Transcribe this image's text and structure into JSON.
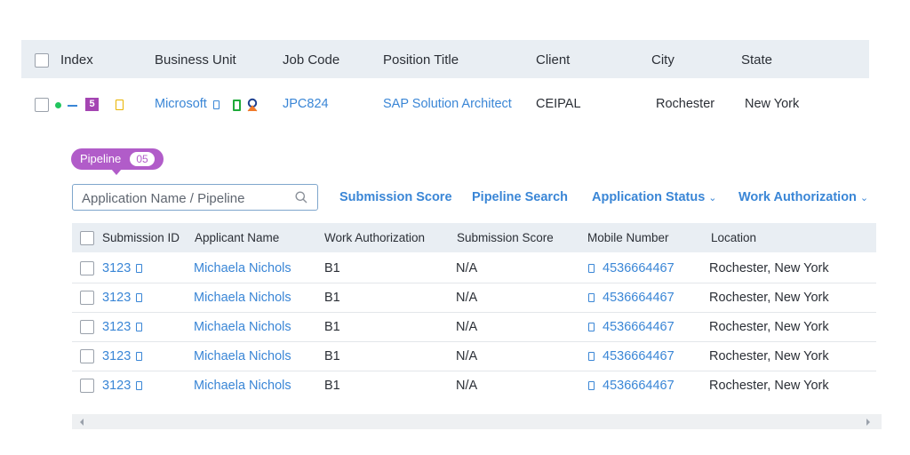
{
  "main_table": {
    "headers": [
      "Index",
      "Business Unit",
      "Job Code",
      "Position Title",
      "Client",
      "City",
      "State"
    ],
    "row": {
      "index_badge": "5",
      "business_unit": "Microsoft",
      "job_code": "JPC824",
      "position_title": "SAP Solution Architect",
      "client": "CEIPAL",
      "city": "Rochester",
      "state": "New York"
    }
  },
  "pipeline": {
    "label": "Pipeline",
    "count": "05",
    "search_placeholder": "Application Name / Pipeline",
    "filters": {
      "submission_score": "Submission Score",
      "pipeline_search": "Pipeline Search",
      "application_status": "Application Status",
      "work_authorization": "Work Authorization"
    }
  },
  "sub_table": {
    "headers": [
      "Submission ID",
      "Applicant Name",
      "Work Authorization",
      "Submission Score",
      "Mobile Number",
      "Location"
    ],
    "rows": [
      {
        "submission_id": "3123",
        "applicant_name": "Michaela Nichols",
        "work_authorization": "B1",
        "submission_score": "N/A",
        "mobile": "4536664467",
        "location": "Rochester, New York"
      },
      {
        "submission_id": "3123",
        "applicant_name": "Michaela Nichols",
        "work_authorization": "B1",
        "submission_score": "N/A",
        "mobile": "4536664467",
        "location": "Rochester, New York"
      },
      {
        "submission_id": "3123",
        "applicant_name": "Michaela Nichols",
        "work_authorization": "B1",
        "submission_score": "N/A",
        "mobile": "4536664467",
        "location": "Rochester, New York"
      },
      {
        "submission_id": "3123",
        "applicant_name": "Michaela Nichols",
        "work_authorization": "B1",
        "submission_score": "N/A",
        "mobile": "4536664467",
        "location": "Rochester, New York"
      },
      {
        "submission_id": "3123",
        "applicant_name": "Michaela Nichols",
        "work_authorization": "B1",
        "submission_score": "N/A",
        "mobile": "4536664467",
        "location": "Rochester, New York"
      }
    ]
  },
  "colors": {
    "link": "#3a86d6",
    "pipeline_purple": "#b15cc9",
    "status_green": "#22c55e",
    "header_bg": "#e9eef3",
    "badge_purple": "#a445b2",
    "icon_yellow": "#e9b400",
    "icon_green": "#1faa3a"
  },
  "icons": [
    "checkbox",
    "status-dot-icon",
    "dash-icon",
    "notes-icon",
    "document-icon",
    "mobile-icon",
    "avatar-icon",
    "search-icon",
    "chevron-down-icon",
    "scroll-left-icon",
    "scroll-right-icon"
  ]
}
